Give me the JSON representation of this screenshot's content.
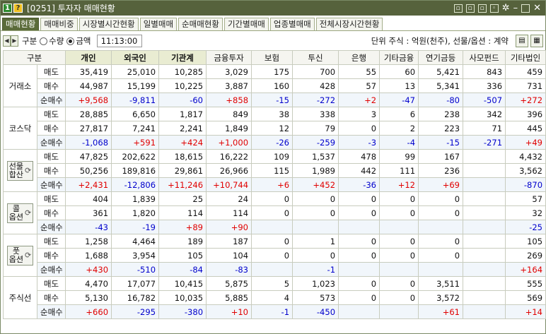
{
  "window": {
    "badge1": "1",
    "badge2": "?",
    "title": "[0251] 투자자 매매현황"
  },
  "tabs": [
    "매매현황",
    "매매비중",
    "시장별시간현황",
    "일별매매",
    "순매매현황",
    "기간별매매",
    "업종별매매",
    "전체시장시간현황"
  ],
  "toolbar": {
    "gubun_label": "구분",
    "radio_qty": "수량",
    "radio_amt": "금액",
    "time": "11:13:00",
    "unit": "단위 주식 : 억원(천주), 선물/옵션 : 계약"
  },
  "headers": [
    "구분",
    "개인",
    "외국인",
    "기관계",
    "금융투자",
    "보험",
    "투신",
    "은행",
    "기타금융",
    "연기금등",
    "사모펀드",
    "기타법인"
  ],
  "row_labels": [
    "매도",
    "매수",
    "순매수"
  ],
  "groups": [
    {
      "name": "거래소",
      "button": false,
      "rows": [
        [
          "35,419",
          "25,010",
          "10,285",
          "3,029",
          "175",
          "700",
          "55",
          "60",
          "5,421",
          "843",
          "459"
        ],
        [
          "44,987",
          "15,199",
          "10,225",
          "3,887",
          "160",
          "428",
          "57",
          "13",
          "5,341",
          "336",
          "731"
        ],
        [
          "+9,568",
          "-9,811",
          "-60",
          "+858",
          "-15",
          "-272",
          "+2",
          "-47",
          "-80",
          "-507",
          "+272"
        ]
      ]
    },
    {
      "name": "코스닥",
      "button": false,
      "rows": [
        [
          "28,885",
          "6,650",
          "1,817",
          "849",
          "38",
          "338",
          "3",
          "6",
          "238",
          "342",
          "396"
        ],
        [
          "27,817",
          "7,241",
          "2,241",
          "1,849",
          "12",
          "79",
          "0",
          "2",
          "223",
          "71",
          "445"
        ],
        [
          "-1,068",
          "+591",
          "+424",
          "+1,000",
          "-26",
          "-259",
          "-3",
          "-4",
          "-15",
          "-271",
          "+49"
        ]
      ]
    },
    {
      "name": "선물",
      "name2": "합산",
      "button": true,
      "rows": [
        [
          "47,825",
          "202,622",
          "18,615",
          "16,222",
          "109",
          "1,537",
          "478",
          "99",
          "167",
          "",
          "4,432"
        ],
        [
          "50,256",
          "189,816",
          "29,861",
          "26,966",
          "115",
          "1,989",
          "442",
          "111",
          "236",
          "",
          "3,562"
        ],
        [
          "+2,431",
          "-12,806",
          "+11,246",
          "+10,744",
          "+6",
          "+452",
          "-36",
          "+12",
          "+69",
          "",
          "-870"
        ]
      ]
    },
    {
      "name": "콜",
      "name2": "옵션",
      "button": true,
      "rows": [
        [
          "404",
          "1,839",
          "25",
          "24",
          "0",
          "0",
          "0",
          "0",
          "0",
          "",
          "57"
        ],
        [
          "361",
          "1,820",
          "114",
          "114",
          "0",
          "0",
          "0",
          "0",
          "0",
          "",
          "32"
        ],
        [
          "-43",
          "-19",
          "+89",
          "+90",
          "",
          "",
          "",
          "",
          "",
          "",
          "-25"
        ]
      ]
    },
    {
      "name": "풋",
      "name2": "옵션",
      "button": true,
      "rows": [
        [
          "1,258",
          "4,464",
          "189",
          "187",
          "0",
          "1",
          "0",
          "0",
          "0",
          "",
          "105"
        ],
        [
          "1,688",
          "3,954",
          "105",
          "104",
          "0",
          "0",
          "0",
          "0",
          "0",
          "",
          "269"
        ],
        [
          "+430",
          "-510",
          "-84",
          "-83",
          "",
          "-1",
          "",
          "",
          "",
          "",
          "+164"
        ]
      ]
    },
    {
      "name": "주식선",
      "button": false,
      "rows": [
        [
          "4,470",
          "17,077",
          "10,415",
          "5,875",
          "5",
          "1,023",
          "0",
          "0",
          "3,511",
          "",
          "555"
        ],
        [
          "5,130",
          "16,782",
          "10,035",
          "5,885",
          "4",
          "573",
          "0",
          "0",
          "3,572",
          "",
          "569"
        ],
        [
          "+660",
          "-295",
          "-380",
          "+10",
          "-1",
          "-450",
          "",
          "",
          "+61",
          "",
          "+14"
        ]
      ]
    }
  ],
  "colors": {
    "title_bar": "#56623c",
    "positive": "#e00000",
    "negative": "#0000cc",
    "active_tab": "#5b6b3a"
  }
}
